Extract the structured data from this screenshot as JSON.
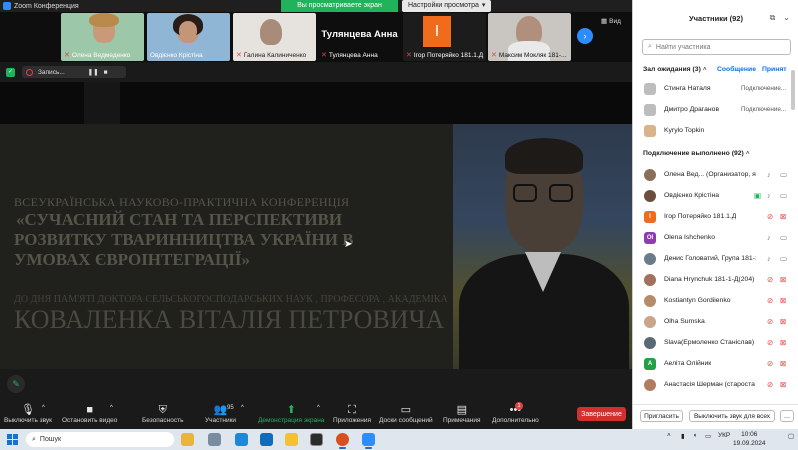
{
  "app": {
    "title": "Zoom Конференция"
  },
  "share_banner": {
    "viewing": "Вы просматриваете экран Овдієнко Крістіна",
    "settings": "Настройки просмотра"
  },
  "gallery": {
    "tiles": [
      {
        "name": "Олена Ведмеденко"
      },
      {
        "name": "Овдієнко Крістіна"
      },
      {
        "name": "Галина Калиниченко"
      },
      {
        "name": "Тулянцева Анна",
        "big": "Тулянцева Анна"
      },
      {
        "name": "Ігор Потеряйко 181.1.Д",
        "initial": "I"
      },
      {
        "name": "Максим Мокляк 181-..."
      }
    ],
    "view_label": "Вид"
  },
  "recording": {
    "label": "Запись..."
  },
  "slide": {
    "conference": "ВСЕУКРАЇНСЬКА НАУКОВО-ПРАКТИЧНА КОНФЕРЕНЦІЯ",
    "title_1": "«СУЧАСНИЙ СТАН ТА ПЕРСПЕКТИВИ",
    "title_2": "РОЗВИТКУ ТВАРИННИЦТВА УКРАЇНИ В",
    "title_3": "УМОВАХ ЄВРОІНТЕГРАЦІЇ»",
    "dedication": "ДО ДНЯ ПАМ'ЯТІ ДОКТОРА СЕЛЬСЬКОГОСПОДАРСЬКИХ НАУК , ПРОФЕСОРА , АКАДЕМІКА",
    "person": "КОВАЛЕНКА ВІТАЛІЯ ПЕТРОВИЧА"
  },
  "toolbar": {
    "mute": "Выключить звук",
    "video": "Остановить видео",
    "security": "Безопасность",
    "participants": "Участники",
    "participants_count": "95",
    "share": "Демонстрация экрана",
    "apps": "Приложения",
    "whiteboards": "Доски сообщений",
    "notes": "Примечания",
    "more": "Дополнительно",
    "more_badge": "1",
    "end": "Завершение"
  },
  "taskbar": {
    "search": "Пошук",
    "lang": "УКР",
    "time": "10:06",
    "date": "19.09.2024"
  },
  "panel": {
    "title": "Участники (92)",
    "search_placeholder": "Найти участника",
    "waiting_header": "Зал ожидания (3)",
    "waiting_message": "Сообщение",
    "waiting_admit": "Принят",
    "waiting": [
      {
        "name": "Стинга Наталя",
        "status": "Подключение...",
        "color": "#bdbdbd"
      },
      {
        "name": "Дмитро Драганов",
        "status": "Подключение...",
        "color": "#bdbdbd"
      },
      {
        "name": "Kyrylo Topkin",
        "status": "",
        "color": "#d9b38c"
      }
    ],
    "connected_header": "Подключение выполнено (92)",
    "connected": [
      {
        "name": "Олена Вед... (Организатор, я)",
        "initials": "",
        "color": "#8a6d5a",
        "mic": "gray",
        "cam": "gray"
      },
      {
        "name": "Овдієнко Крістіна",
        "initials": "",
        "color": "#6b4e3d",
        "mic": "gray",
        "cam": "gray",
        "sharing": true
      },
      {
        "name": "Ігор Потеряйко 181.1.Д",
        "initials": "I",
        "color": "#f06b1c",
        "mic": "red",
        "cam": "red"
      },
      {
        "name": "Olena Ishchenko",
        "initials": "OI",
        "color": "#8e3bb5",
        "mic": "gray",
        "cam": "gray"
      },
      {
        "name": "Денис Головатий, Група 181-1-3",
        "initials": "",
        "color": "#6a7c8a",
        "mic": "gray",
        "cam": "gray"
      },
      {
        "name": "Diana Hrynchuk 181-1-Д(204)",
        "initials": "",
        "color": "#a2705c",
        "mic": "red",
        "cam": "red"
      },
      {
        "name": "Kostiantyn Gordiienko",
        "initials": "",
        "color": "#b58b6a",
        "mic": "red",
        "cam": "red"
      },
      {
        "name": "Olha Sumska",
        "initials": "",
        "color": "#caa58a",
        "mic": "red",
        "cam": "red"
      },
      {
        "name": "Slava(Ермоленко Станіслав) 18...",
        "initials": "",
        "color": "#5a6a73",
        "mic": "red",
        "cam": "red"
      },
      {
        "name": "Аеліта Олійник",
        "initials": "A",
        "color": "#24a148",
        "mic": "red",
        "cam": "red"
      },
      {
        "name": "Анастасія Шерман (староста 18...",
        "initials": "",
        "color": "#b07b5e",
        "mic": "red",
        "cam": "red"
      }
    ],
    "invite": "Пригласить",
    "mute_all": "Выключить звук для всех"
  }
}
